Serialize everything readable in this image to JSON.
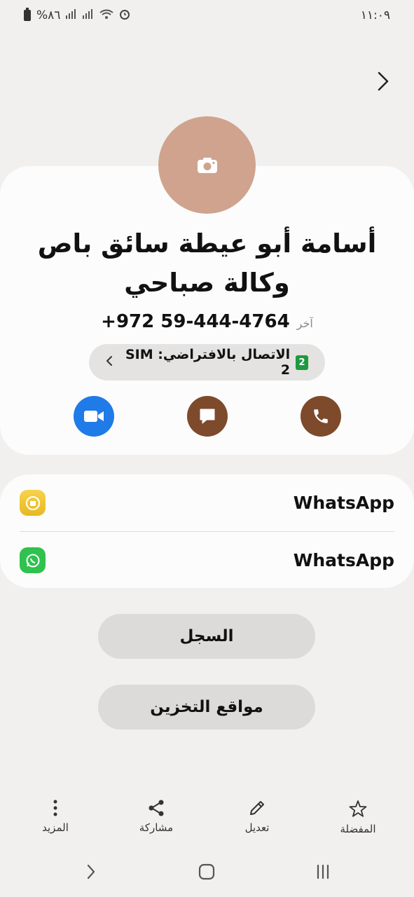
{
  "status_bar": {
    "time": "١١:٠٩",
    "battery": "%٨٦"
  },
  "contact": {
    "name": "أسامة أبو عيطة سائق باص وكالة صباحي",
    "phone": "+972 59-444-4764",
    "phone_label": "آخر"
  },
  "sim": {
    "label": "الاتصال بالافتراضي: SIM 2",
    "badge": "2"
  },
  "actions": [
    {
      "name": "video-call",
      "icon": "video-icon",
      "color": "#1f7be8"
    },
    {
      "name": "message",
      "icon": "message-icon",
      "color": "#7d4a2c"
    },
    {
      "name": "call",
      "icon": "phone-icon",
      "color": "#7d4a2c"
    }
  ],
  "apps": [
    {
      "label": "WhatsApp",
      "icon": "whatsapp-business-icon",
      "color": "#f2c93a"
    },
    {
      "label": "WhatsApp",
      "icon": "whatsapp-icon",
      "color": "#2fc24e"
    }
  ],
  "buttons": {
    "log": "السجل",
    "storage": "مواقع التخزين"
  },
  "bottom_bar": {
    "more": "المزيد",
    "share": "مشاركة",
    "edit": "تعديل",
    "favorite": "المفضلة"
  }
}
